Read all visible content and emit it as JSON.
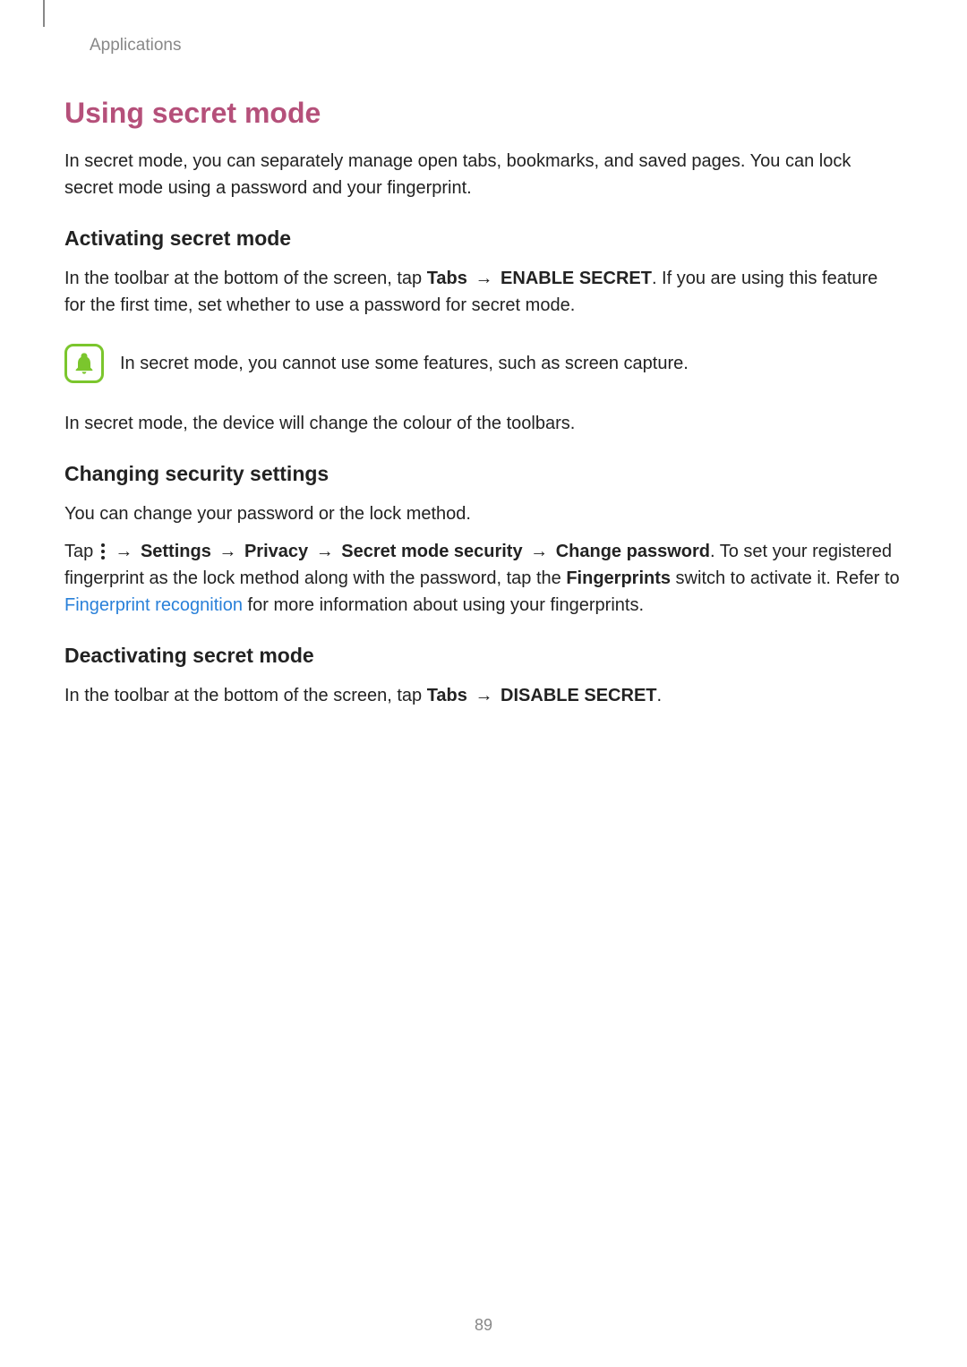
{
  "header": {
    "section": "Applications"
  },
  "title": "Using secret mode",
  "intro": "In secret mode, you can separately manage open tabs, bookmarks, and saved pages. You can lock secret mode using a password and your fingerprint.",
  "activating": {
    "heading": "Activating secret mode",
    "p1_part1": "In the toolbar at the bottom of the screen, tap ",
    "p1_tabs": "Tabs",
    "p1_arrow": " → ",
    "p1_enable": "ENABLE SECRET",
    "p1_part2": ". If you are using this feature for the first time, set whether to use a password for secret mode.",
    "note": "In secret mode, you cannot use some features, such as screen capture.",
    "p2": "In secret mode, the device will change the colour of the toolbars."
  },
  "changing": {
    "heading": "Changing security settings",
    "p1": "You can change your password or the lock method.",
    "p2_tap": "Tap ",
    "p2_arrow1": " → ",
    "p2_settings": "Settings",
    "p2_arrow2": " → ",
    "p2_privacy": "Privacy",
    "p2_arrow3": " → ",
    "p2_secret": "Secret mode security",
    "p2_arrow4": " → ",
    "p2_change": "Change password",
    "p2_part2": ". To set your registered fingerprint as the lock method along with the password, tap the ",
    "p2_fingerprints": "Fingerprints",
    "p2_part3": " switch to activate it. Refer to ",
    "p2_link": "Fingerprint recognition",
    "p2_part4": " for more information about using your fingerprints."
  },
  "deactivating": {
    "heading": "Deactivating secret mode",
    "p1_part1": "In the toolbar at the bottom of the screen, tap ",
    "p1_tabs": "Tabs",
    "p1_arrow": " → ",
    "p1_disable": "DISABLE SECRET",
    "p1_period": "."
  },
  "footer": {
    "page": "89"
  }
}
